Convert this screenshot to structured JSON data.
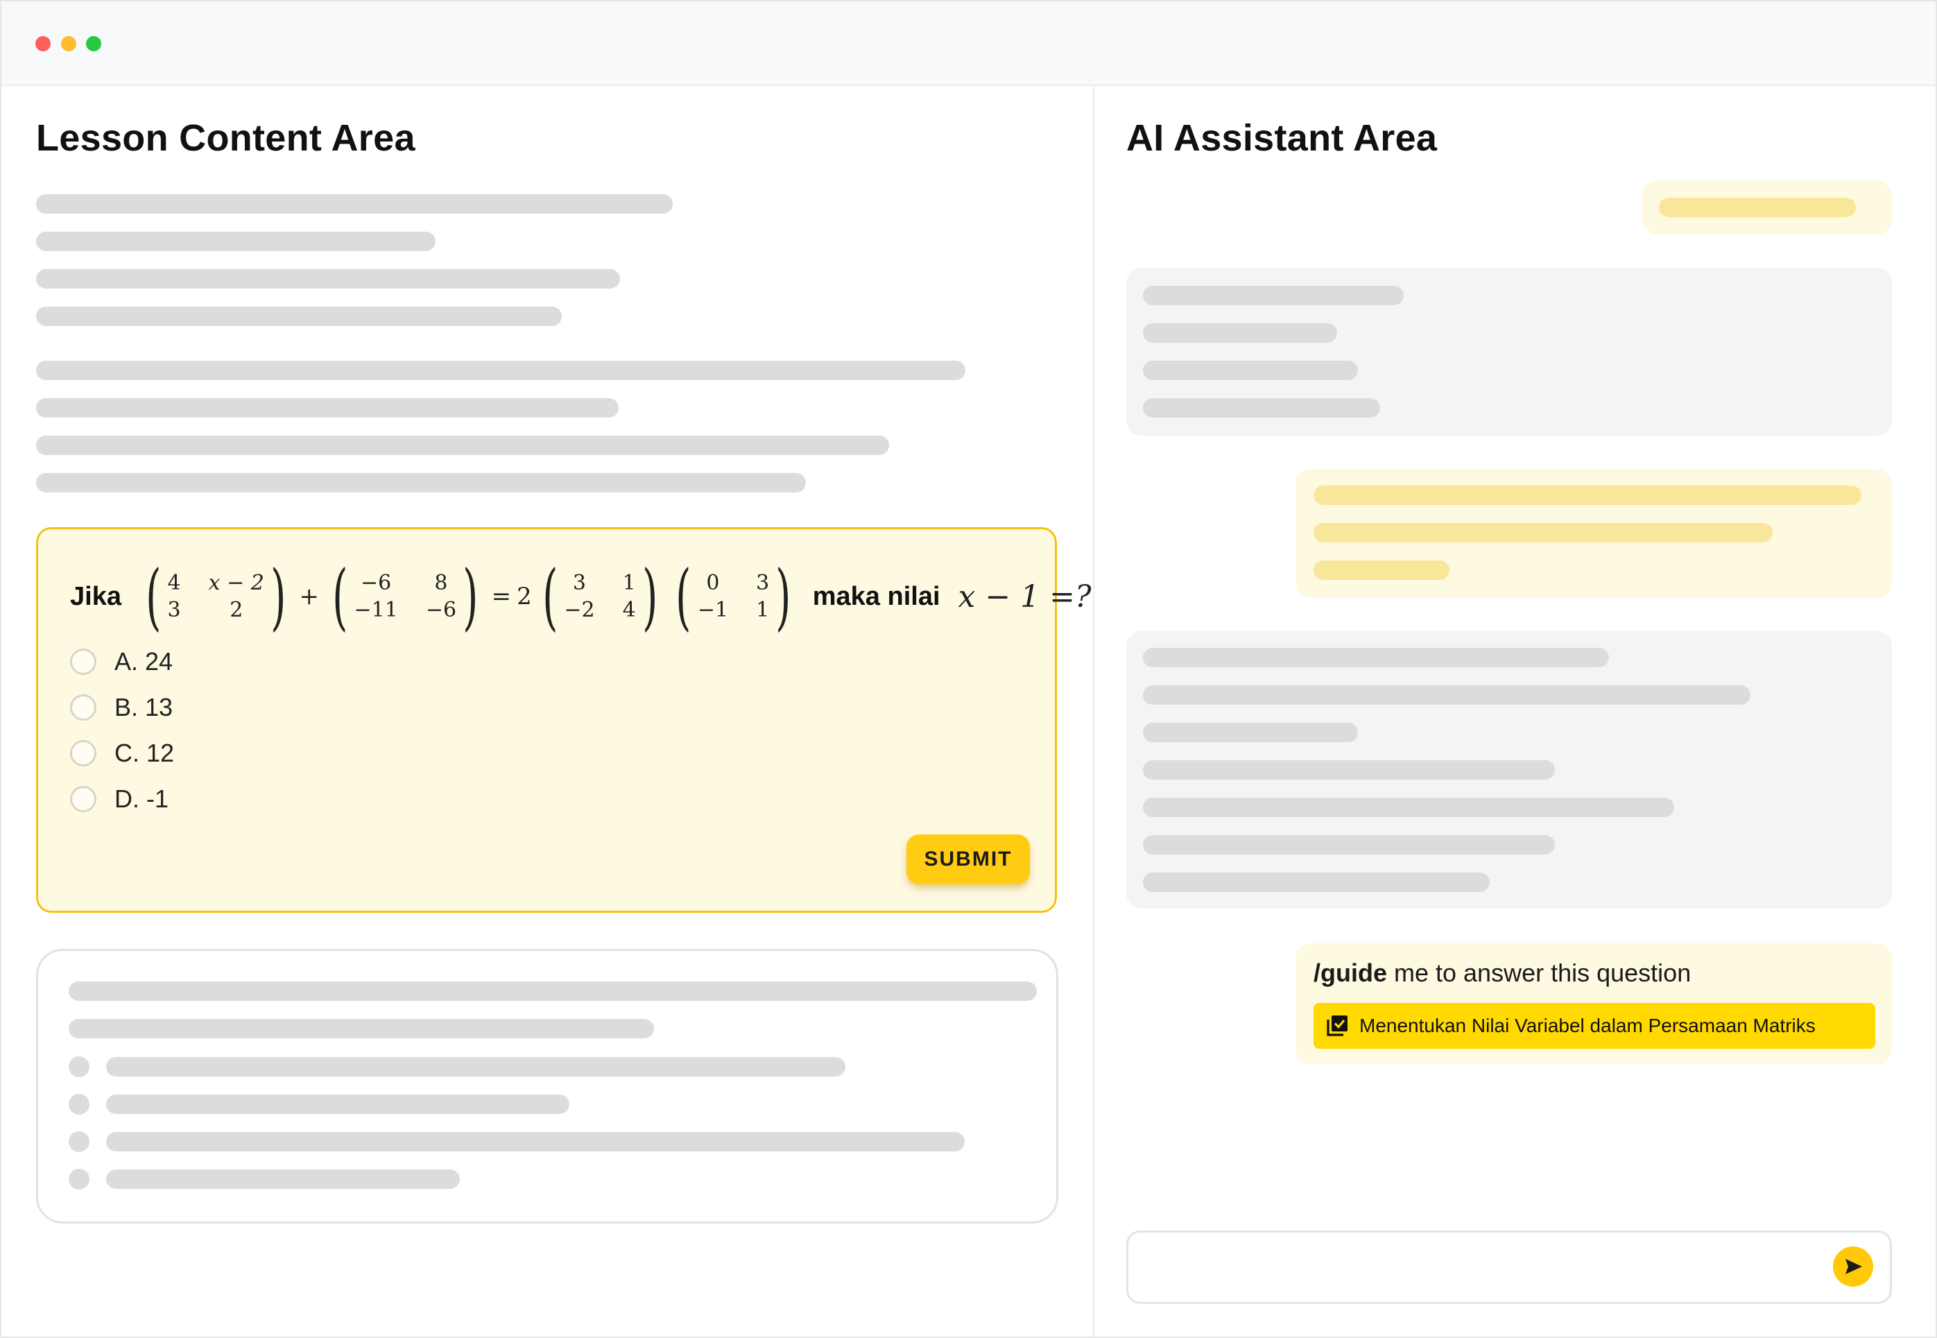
{
  "lesson": {
    "title": "Lesson Content Area",
    "question": {
      "prefix": "Jika",
      "connector": "maka nilai",
      "matrix_a": [
        "4",
        "x − 2",
        "3",
        "2"
      ],
      "matrix_b": [
        "−6",
        "8",
        "−11",
        "−6"
      ],
      "scalar": "2",
      "matrix_c": [
        "3",
        "1",
        "−2",
        "4"
      ],
      "matrix_d": [
        "0",
        "3",
        "−1",
        "1"
      ],
      "plus": "+",
      "equals": "=",
      "target": "x − 1 =?",
      "options": [
        {
          "label": "A. 24"
        },
        {
          "label": "B. 13"
        },
        {
          "label": "C. 12"
        },
        {
          "label": "D. -1"
        }
      ],
      "submit_label": "SUBMIT"
    }
  },
  "assistant": {
    "title": "AI Assistant Area",
    "guide_message": {
      "command": "/guide",
      "text": " me to answer this question",
      "topic": "Menentukan Nilai Variabel dalam Persamaan Matriks"
    },
    "input": {
      "value": "",
      "placeholder": ""
    }
  },
  "colors": {
    "accent": "#ffcc12",
    "card_background": "#fef9e1",
    "card_border": "#f4c313",
    "chip": "#ffd900",
    "skeleton": "#dcdcdc",
    "skeleton_yellow": "#f8e79b",
    "ai_bubble": "#f4f4f4",
    "window_controls": [
      "#ff5f57",
      "#febc2e",
      "#28c840"
    ]
  },
  "icons": {
    "send": "send-arrow-icon",
    "topic": "checkbox-stack-icon"
  }
}
